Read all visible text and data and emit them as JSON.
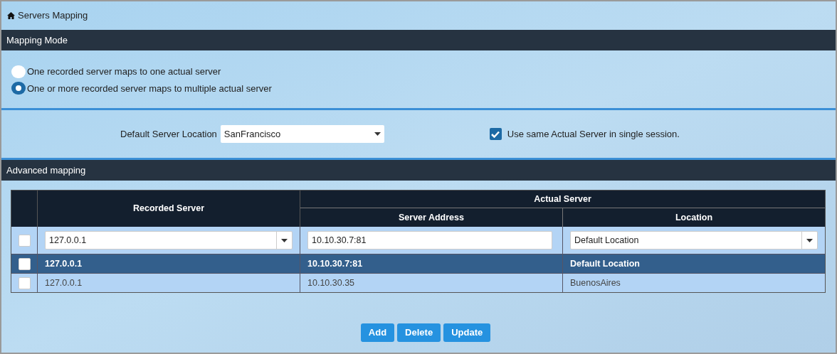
{
  "window": {
    "title": "Servers Mapping"
  },
  "mapping_mode": {
    "header": "Mapping Mode",
    "options": [
      {
        "label": "One recorded server maps to one actual server",
        "selected": false
      },
      {
        "label": "One or more recorded server maps to multiple actual server",
        "selected": true
      }
    ]
  },
  "defaults": {
    "location_label": "Default Server Location",
    "location_value": "SanFrancisco",
    "same_server": {
      "label": "Use same Actual Server in single session.",
      "checked": true
    }
  },
  "advanced": {
    "header": "Advanced mapping",
    "table": {
      "columns": {
        "recorded": "Recorded Server",
        "actual": "Actual Server",
        "address": "Server Address",
        "location": "Location"
      },
      "edit_row": {
        "checked": false,
        "recorded": "127.0.0.1",
        "address": "10.10.30.7:81",
        "location": "Default Location"
      },
      "rows": [
        {
          "checked": false,
          "selected": true,
          "recorded": "127.0.0.1",
          "address": "10.10.30.7:81",
          "location": "Default Location"
        },
        {
          "checked": false,
          "selected": false,
          "recorded": "127.0.0.1",
          "address": "10.10.30.35",
          "location": "BuenosAires"
        }
      ]
    },
    "buttons": [
      "Add",
      "Delete",
      "Update"
    ]
  }
}
